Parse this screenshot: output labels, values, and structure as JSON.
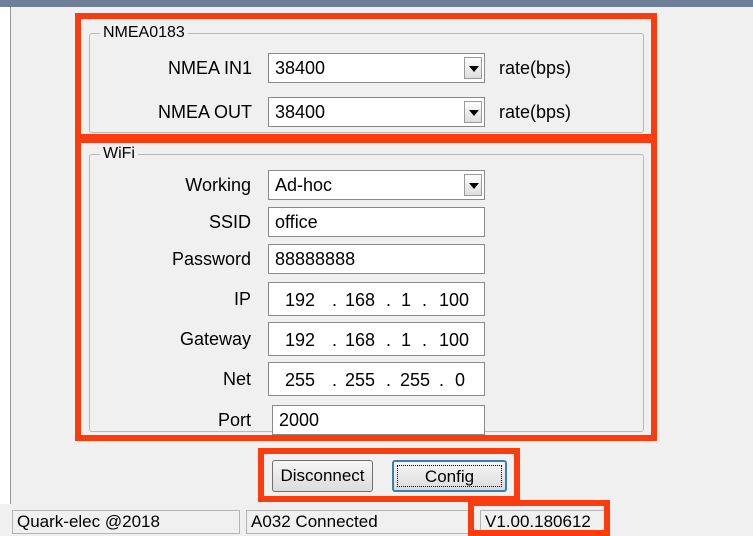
{
  "nmea": {
    "legend": "NMEA0183",
    "in": {
      "label": "NMEA IN1",
      "value": "38400",
      "unit": "rate(bps)"
    },
    "out": {
      "label": "NMEA OUT",
      "value": "38400",
      "unit": "rate(bps)"
    }
  },
  "wifi": {
    "legend": "WiFi",
    "working": {
      "label": "Working",
      "value": "Ad-hoc"
    },
    "ssid": {
      "label": "SSID",
      "value": "office"
    },
    "password": {
      "label": "Password",
      "value": "88888888"
    },
    "ip": {
      "label": "IP",
      "octets": [
        "192",
        "168",
        "1",
        "100"
      ]
    },
    "gateway": {
      "label": "Gateway",
      "octets": [
        "192",
        "168",
        "1",
        "100"
      ]
    },
    "net": {
      "label": "Net",
      "octets": [
        "255",
        "255",
        "255",
        "0"
      ]
    },
    "port": {
      "label": "Port",
      "value": "2000"
    }
  },
  "buttons": {
    "disconnect": "Disconnect",
    "config": "Config"
  },
  "status": {
    "copyright": "Quark-elec @2018",
    "connection": "A032 Connected",
    "version": "V1.00.180612"
  },
  "colors": {
    "highlight": "#fa3c0f",
    "dialog_bg": "#f0f0f0"
  },
  "icons": {
    "dropdown": "chevron-down-icon"
  }
}
